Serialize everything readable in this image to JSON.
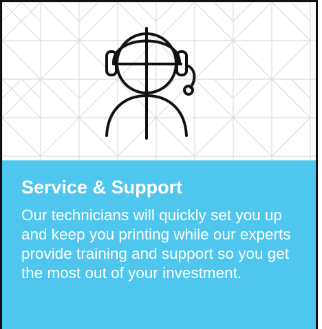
{
  "card": {
    "title": "Service & Support",
    "description": "Our technicians will quickly set you up and keep you printing while our experts provide training and support so you get the most out of your investment.",
    "icon": "headset-support-agent-icon"
  },
  "colors": {
    "panel_background": "#4ec6ee",
    "text": "#ffffff",
    "pattern_lines": "#d9d9d9",
    "icon_stroke": "#111111",
    "border": "#111111"
  }
}
